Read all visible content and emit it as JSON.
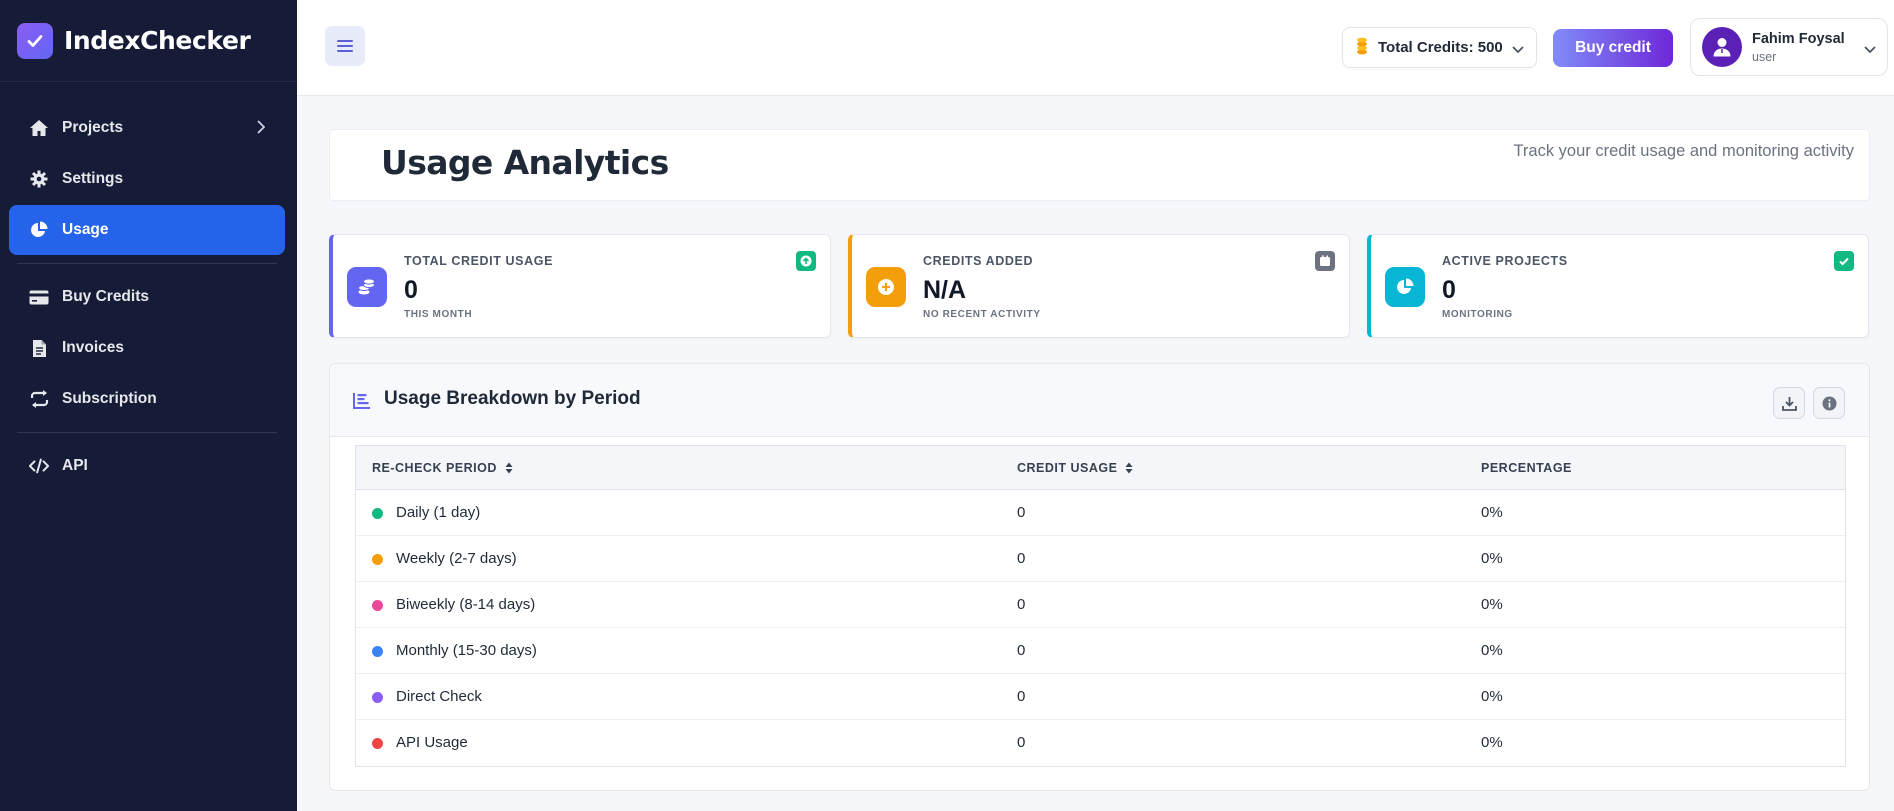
{
  "app": {
    "name": "IndexChecker"
  },
  "sidebar": {
    "items": [
      {
        "label": "Projects",
        "icon": "home-icon"
      },
      {
        "label": "Settings",
        "icon": "gear-icon"
      },
      {
        "label": "Usage",
        "icon": "pie-chart-icon",
        "active": true
      },
      {
        "label": "Buy Credits",
        "icon": "credit-card-icon"
      },
      {
        "label": "Invoices",
        "icon": "document-icon"
      },
      {
        "label": "Subscription",
        "icon": "repeat-icon"
      },
      {
        "label": "API",
        "icon": "code-icon"
      }
    ]
  },
  "header": {
    "credits_label": "Total Credits: 500",
    "buy_label": "Buy credit",
    "user": {
      "name": "Fahim Foysal",
      "role": "user"
    }
  },
  "page": {
    "title": "Usage Analytics",
    "subtitle": "Track your credit usage and monitoring activity"
  },
  "stats": [
    {
      "label": "TOTAL CREDIT USAGE",
      "value": "0",
      "sub": "THIS MONTH",
      "color": "#6366f1",
      "badge_color": "#10b981",
      "icon": "coins-icon",
      "badge_icon": "arrow-up-icon"
    },
    {
      "label": "CREDITS ADDED",
      "value": "N/A",
      "sub": "NO RECENT ACTIVITY",
      "color": "#f59e0b",
      "badge_color": "#6b7280",
      "icon": "plus-coin-icon",
      "badge_icon": "calendar-icon"
    },
    {
      "label": "ACTIVE PROJECTS",
      "value": "0",
      "sub": "MONITORING",
      "color": "#06b6d4",
      "badge_color": "#10b981",
      "icon": "pie-chart-icon",
      "badge_icon": "check-icon"
    }
  ],
  "breakdown": {
    "title": "Usage Breakdown by Period",
    "columns": [
      "RE-CHECK PERIOD",
      "CREDIT USAGE",
      "PERCENTAGE"
    ],
    "rows": [
      {
        "period": "Daily (1 day)",
        "usage": "0",
        "percentage": "0%",
        "color": "#10b981"
      },
      {
        "period": "Weekly (2-7 days)",
        "usage": "0",
        "percentage": "0%",
        "color": "#f59e0b"
      },
      {
        "period": "Biweekly (8-14 days)",
        "usage": "0",
        "percentage": "0%",
        "color": "#ec4899"
      },
      {
        "period": "Monthly (15-30 days)",
        "usage": "0",
        "percentage": "0%",
        "color": "#3b82f6"
      },
      {
        "period": "Direct Check",
        "usage": "0",
        "percentage": "0%",
        "color": "#8b5cf6"
      },
      {
        "period": "API Usage",
        "usage": "0",
        "percentage": "0%",
        "color": "#ef4444"
      }
    ]
  }
}
